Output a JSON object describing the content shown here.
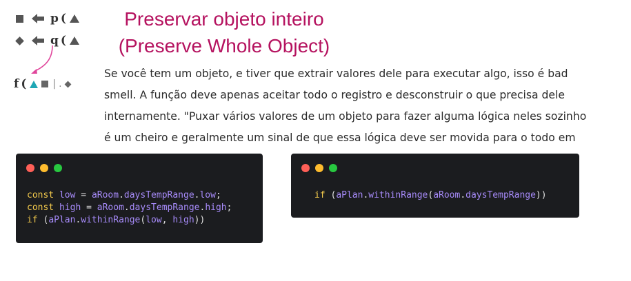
{
  "diagram": {
    "row_p": {
      "name": "p",
      "paren": "("
    },
    "row_q": {
      "name": "q",
      "paren": "("
    },
    "row_f": {
      "name": "f",
      "paren": "(",
      "bar": "|",
      "dot": "."
    }
  },
  "title": {
    "line1": "Preservar objeto inteiro",
    "line2": "(Preserve Whole Object)"
  },
  "paragraph": "Se você tem um objeto, e tiver que extrair valores dele para executar algo, isso é bad smell. A função deve apenas aceitar todo o registro e desconstruir o que precisa dele internamente. \"Puxar vários valores de um objeto para fazer alguma lógica neles sozinho é um cheiro e geralmente um sinal de que essa lógica deve ser movida para o todo em si.\"",
  "code_before": {
    "line1": {
      "kw": "const",
      "name": "low",
      "eq": " = ",
      "obj": "aRoom",
      "d1": ".",
      "prop": "daysTempRange",
      "d2": ".",
      "field": "low",
      "end": ";"
    },
    "line2": {
      "kw": "const",
      "name": "high",
      "eq": " = ",
      "obj": "aRoom",
      "d1": ".",
      "prop": "daysTempRange",
      "d2": ".",
      "field": "high",
      "end": ";"
    },
    "line3": {
      "kw": "if",
      "open": " (",
      "obj": "aPlan",
      "d1": ".",
      "method": "withinRange",
      "p1": "(",
      "a1": "low",
      "comma": ", ",
      "a2": "high",
      "close": "))"
    }
  },
  "code_after": {
    "line1": {
      "kw": "if",
      "open": " (",
      "obj": "aPlan",
      "d1": ".",
      "method": "withinRange",
      "p1": "(",
      "arg_obj": "aRoom",
      "d2": ".",
      "arg_prop": "daysTempRange",
      "close": "))"
    }
  },
  "colors": {
    "title": "#b5125f",
    "code_bg": "#1b1c1f",
    "keyword": "#f2c94c",
    "identifier": "#a78bfa",
    "arrow": "#e0459b",
    "teal_shape": "#1fa7b5"
  }
}
